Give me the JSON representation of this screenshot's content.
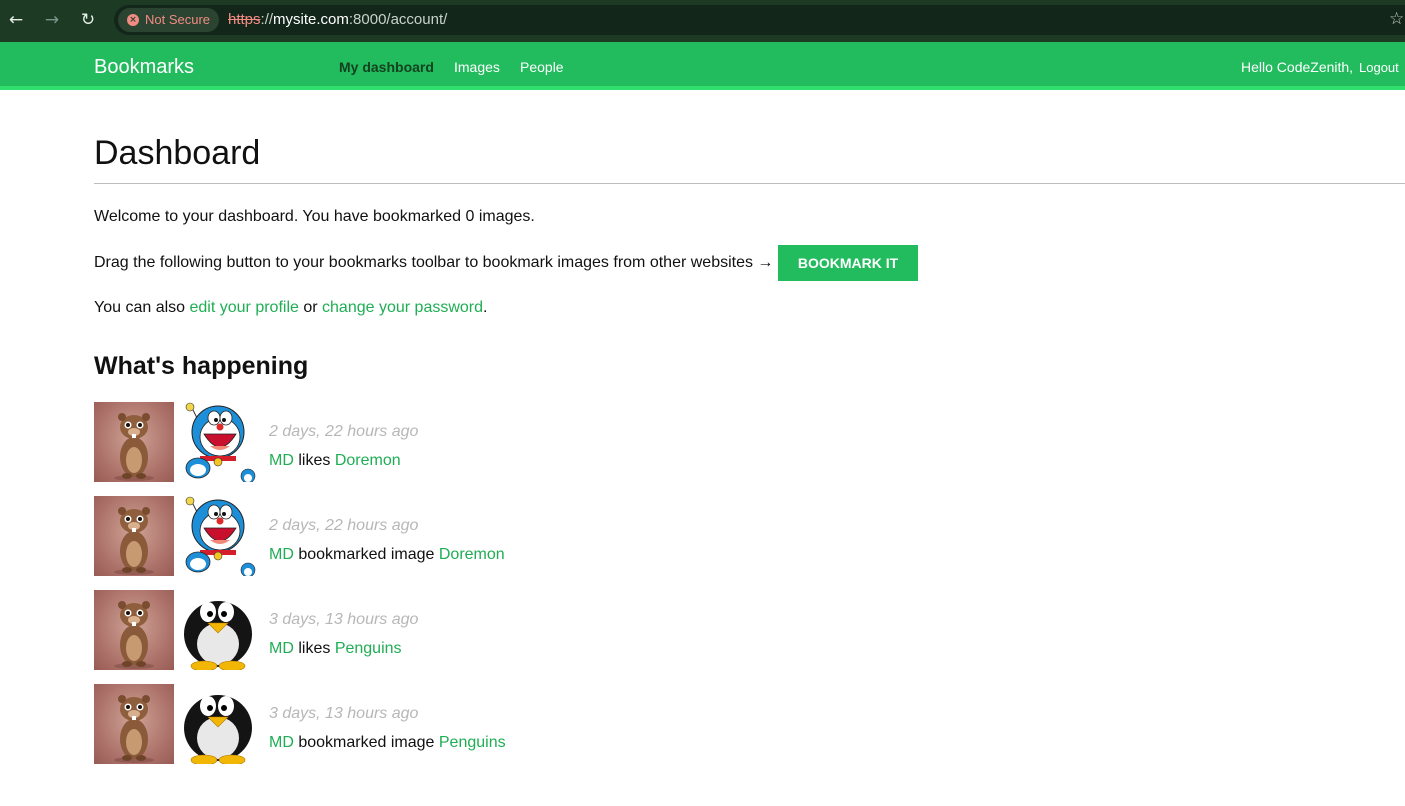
{
  "browser": {
    "security_label": "Not Secure",
    "url_scheme": "https",
    "url_separator": "://",
    "url_host": "mysite.com",
    "url_rest": ":8000/account/",
    "icons": {
      "back": "arrow-left-icon",
      "forward": "arrow-right-icon",
      "reload": "reload-icon",
      "bookmark": "star-icon"
    }
  },
  "header": {
    "logo": "Bookmarks",
    "menu": [
      "My dashboard",
      "Images",
      "People"
    ],
    "active_menu": "My dashboard",
    "greeting": "Hello CodeZenith,",
    "logout": "Logout"
  },
  "main": {
    "title": "Dashboard",
    "welcome": "Welcome to your dashboard. You have bookmarked 0 images.",
    "drag_text": "Drag the following button to your bookmarks toolbar to bookmark images from other websites →",
    "bookmark_button": "BOOKMARK IT",
    "also_prefix": "You can also",
    "edit_profile": "edit your profile",
    "or": "or",
    "change_password": "change your password",
    "period": ".",
    "section_title": "What's happening"
  },
  "actions": [
    {
      "time": "2 days, 22 hours ago",
      "user": "MD",
      "verb": "likes",
      "target": "Doremon",
      "thumb": "doraemon"
    },
    {
      "time": "2 days, 22 hours ago",
      "user": "MD",
      "verb": "bookmarked image",
      "target": "Doremon",
      "thumb": "doraemon"
    },
    {
      "time": "3 days, 13 hours ago",
      "user": "MD",
      "verb": "likes",
      "target": "Penguins",
      "thumb": "penguin"
    },
    {
      "time": "3 days, 13 hours ago",
      "user": "MD",
      "verb": "bookmarked image",
      "target": "Penguins",
      "thumb": "penguin"
    }
  ],
  "colors": {
    "accent": "#22bb5e",
    "link": "#1fae54",
    "chrome": "#1d3a24"
  }
}
